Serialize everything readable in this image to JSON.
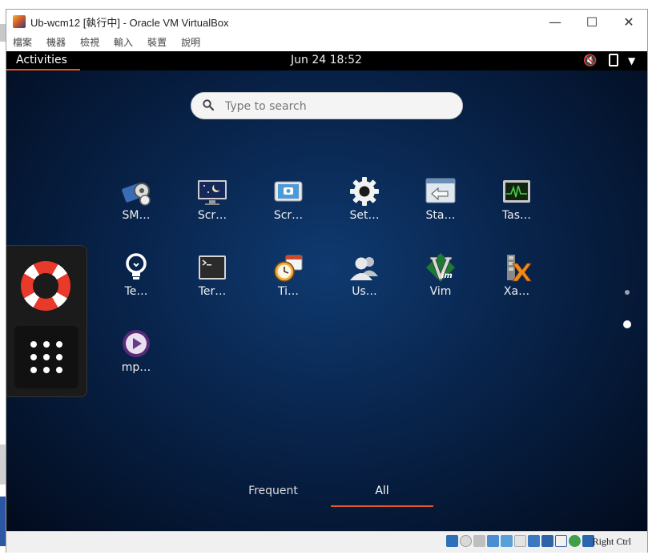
{
  "window": {
    "title": "Ub-wcm12 [執行中] - Oracle VM VirtualBox",
    "controls": {
      "minimize": "—",
      "maximize": "☐",
      "close": "✕"
    }
  },
  "menubar": [
    "檔案",
    "機器",
    "檢視",
    "輸入",
    "裝置",
    "說明"
  ],
  "topbar": {
    "activities": "Activities",
    "clock": "Jun 24  18:52",
    "icons": [
      "volume-muted-icon",
      "battery-icon",
      "system-menu-arrow-icon"
    ]
  },
  "search": {
    "placeholder": "Type to search",
    "value": ""
  },
  "apps": [
    {
      "label": "SM…",
      "icon": "smplayer-icon"
    },
    {
      "label": "Scr…",
      "icon": "screensaver-icon"
    },
    {
      "label": "Scr…",
      "icon": "screenshot-icon"
    },
    {
      "label": "Set…",
      "icon": "settings-gear-icon"
    },
    {
      "label": "Sta…",
      "icon": "startup-applications-icon"
    },
    {
      "label": "Tas…",
      "icon": "task-manager-icon"
    },
    {
      "label": "Te…",
      "icon": "tips-bulb-icon"
    },
    {
      "label": "Ter…",
      "icon": "terminal-icon"
    },
    {
      "label": "Ti…",
      "icon": "time-date-clock-icon"
    },
    {
      "label": "Us…",
      "icon": "users-icon"
    },
    {
      "label": "Vim",
      "icon": "vim-icon"
    },
    {
      "label": "Xa…",
      "icon": "xarchiver-icon"
    },
    {
      "label": "mp…",
      "icon": "media-player-icon"
    }
  ],
  "dash": {
    "items": [
      "help-lifebuoy-icon",
      "show-applications-grid-icon"
    ]
  },
  "view_tabs": {
    "frequent": "Frequent",
    "all": "All",
    "active": "All"
  },
  "statusbar": {
    "host_key": "Right Ctrl"
  },
  "colors": {
    "accent": "#e95420",
    "topbar": "#000000",
    "desktop": "#08234a"
  }
}
